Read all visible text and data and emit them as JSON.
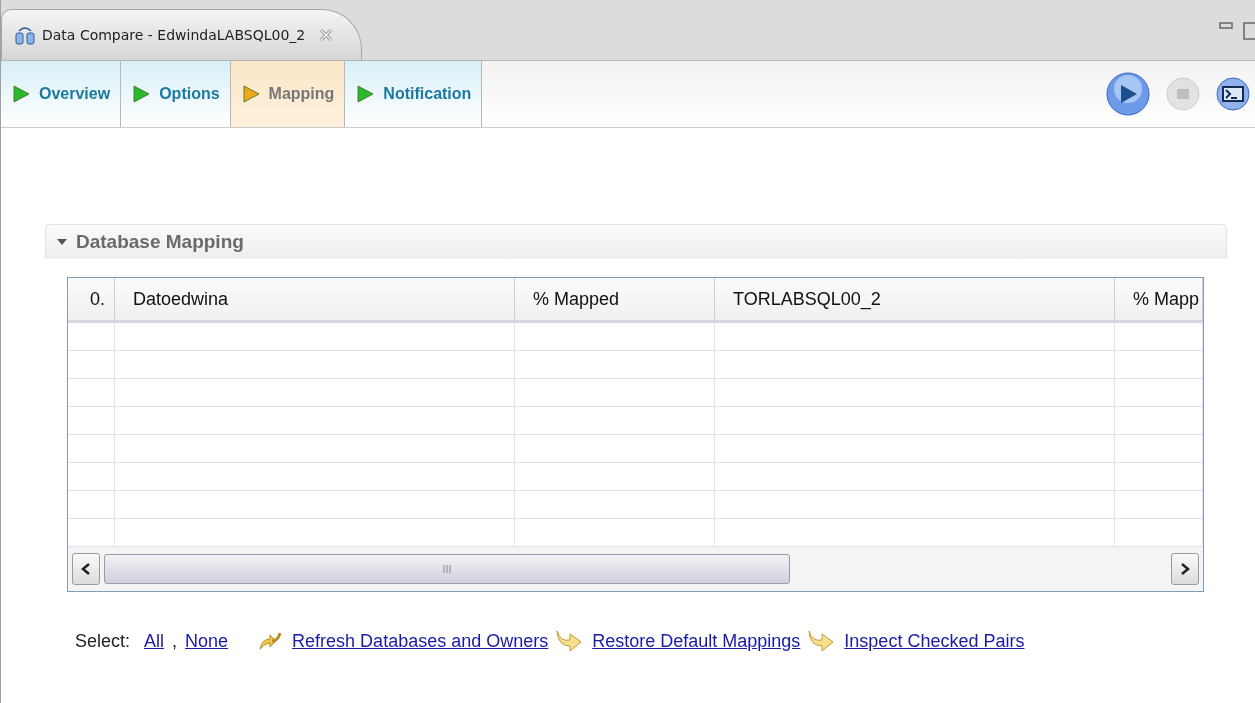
{
  "editor_tab": {
    "title": "Data Compare - EdwindaLABSQL00_2",
    "closable": true
  },
  "page_tabs": [
    {
      "label": "Overview",
      "selected": false
    },
    {
      "label": "Options",
      "selected": false
    },
    {
      "label": "Mapping",
      "selected": true
    },
    {
      "label": "Notification",
      "selected": false
    }
  ],
  "toolbar": [
    {
      "kind": "run",
      "disabled": false
    },
    {
      "kind": "stop",
      "disabled": true
    },
    {
      "kind": "console",
      "disabled": false
    }
  ],
  "section": {
    "title": "Database Mapping",
    "expanded": true,
    "table": {
      "columns": [
        "0.",
        "Datoedwina",
        "% Mapped",
        "TORLABSQL00_2",
        "% Mapp"
      ]
    }
  },
  "select": {
    "label": "Select:",
    "links": [
      "All",
      "None"
    ],
    "separator": ","
  },
  "actions": [
    {
      "kind": "refresh",
      "label": "Refresh Databases and Owners"
    },
    {
      "kind": "arrow",
      "label": "Restore Default Mappings"
    },
    {
      "kind": "arrow",
      "label": "Inspect Checked Pairs"
    }
  ]
}
